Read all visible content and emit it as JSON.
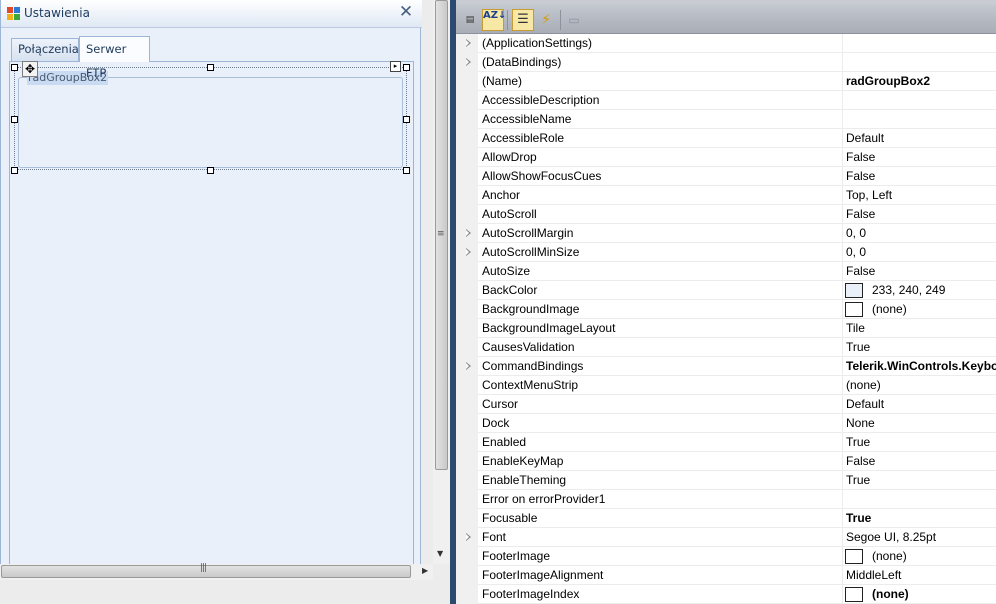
{
  "form": {
    "title": "Ustawienia",
    "close_glyph": "✕",
    "tabs": [
      "Połączenia",
      "Serwer FTP"
    ],
    "groupbox_label": "radGroupBox2",
    "move_glyph": "✥",
    "smart_tag_glyph": "▸"
  },
  "scrollbars": {
    "v_grip": "≡",
    "v_down": "▼",
    "h_grip": "|||",
    "h_right": "▶"
  },
  "toolbar": {
    "categorized_icon": "categorized-icon",
    "categorized_glyph": "▤",
    "alphabetical_glyph": "AZ↓",
    "properties_glyph": "☰",
    "events_glyph": "⚡",
    "pages_glyph": "▭"
  },
  "properties": [
    {
      "name": "(ApplicationSettings)",
      "value": "",
      "expandable": true
    },
    {
      "name": "(DataBindings)",
      "value": "",
      "expandable": true
    },
    {
      "name": "(Name)",
      "value": "radGroupBox2",
      "bold": true
    },
    {
      "name": "AccessibleDescription",
      "value": ""
    },
    {
      "name": "AccessibleName",
      "value": ""
    },
    {
      "name": "AccessibleRole",
      "value": "Default"
    },
    {
      "name": "AllowDrop",
      "value": "False"
    },
    {
      "name": "AllowShowFocusCues",
      "value": "False"
    },
    {
      "name": "Anchor",
      "value": "Top, Left"
    },
    {
      "name": "AutoScroll",
      "value": "False"
    },
    {
      "name": "AutoScrollMargin",
      "value": "0, 0",
      "expandable": true
    },
    {
      "name": "AutoScrollMinSize",
      "value": "0, 0",
      "expandable": true
    },
    {
      "name": "AutoSize",
      "value": "False"
    },
    {
      "name": "BackColor",
      "value": "233, 240, 249",
      "swatch": "#e9f0f9"
    },
    {
      "name": "BackgroundImage",
      "value": "(none)",
      "swatch": "#ffffff"
    },
    {
      "name": "BackgroundImageLayout",
      "value": "Tile"
    },
    {
      "name": "CausesValidation",
      "value": "True"
    },
    {
      "name": "CommandBindings",
      "value": "Telerik.WinControls.Keyboa",
      "bold": true,
      "expandable": true
    },
    {
      "name": "ContextMenuStrip",
      "value": "(none)"
    },
    {
      "name": "Cursor",
      "value": "Default"
    },
    {
      "name": "Dock",
      "value": "None"
    },
    {
      "name": "Enabled",
      "value": "True"
    },
    {
      "name": "EnableKeyMap",
      "value": "False"
    },
    {
      "name": "EnableTheming",
      "value": "True"
    },
    {
      "name": "Error on errorProvider1",
      "value": ""
    },
    {
      "name": "Focusable",
      "value": "True",
      "bold": true
    },
    {
      "name": "Font",
      "value": "Segoe UI, 8.25pt",
      "expandable": true
    },
    {
      "name": "FooterImage",
      "value": "(none)",
      "swatch": "#ffffff"
    },
    {
      "name": "FooterImageAlignment",
      "value": "MiddleLeft"
    },
    {
      "name": "FooterImageIndex",
      "value": "(none)",
      "swatch": "#ffffff",
      "bold": true
    }
  ],
  "colors": {
    "form_back": "#e9f0f9",
    "splitter": "#2c4a6f",
    "selected_toolbar_button": "#f7e8a6"
  }
}
